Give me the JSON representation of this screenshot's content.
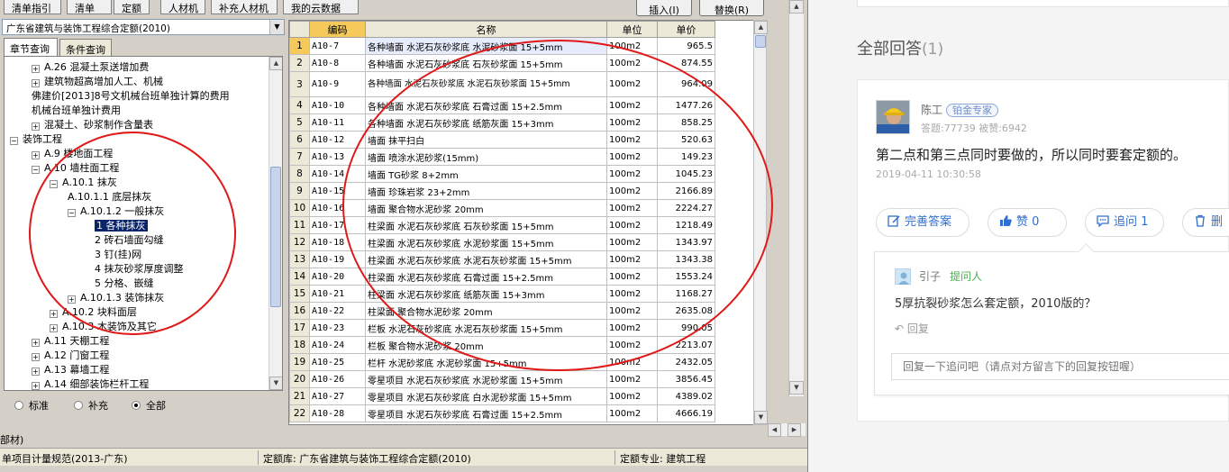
{
  "app": {
    "top_tabs": [
      "清单指引",
      "清单",
      "定额",
      "人材机",
      "补充人材机",
      "我的云数据"
    ],
    "insert_button": "插入(I)",
    "replace_button": "替换(R)",
    "quota_library": "广东省建筑与装饰工程综合定额(2010)",
    "sub_tabs": [
      "章节查询",
      "条件查询"
    ],
    "tree": [
      {
        "label": "A.26 混凝土泵送增加费",
        "level": 1,
        "expander": "+"
      },
      {
        "label": "建筑物超高增加人工、机械",
        "level": 1,
        "expander": "+"
      },
      {
        "label": "佛建价[2013]8号文机械台班单独计算的费用",
        "level": 1,
        "expander": ""
      },
      {
        "label": "机械台班单独计费用",
        "level": 1,
        "expander": ""
      },
      {
        "label": "混凝土、砂浆制作含量表",
        "level": 1,
        "expander": "+"
      },
      {
        "label": "装饰工程",
        "level": 0,
        "expander": "−"
      },
      {
        "label": "A.9 楼地面工程",
        "level": 1,
        "expander": "+"
      },
      {
        "label": "A.10 墙柱面工程",
        "level": 1,
        "expander": "−"
      },
      {
        "label": "A.10.1 抹灰",
        "level": 2,
        "expander": "−"
      },
      {
        "label": "A.10.1.1 底层抹灰",
        "level": 3,
        "expander": ""
      },
      {
        "label": "A.10.1.2 一般抹灰",
        "level": 3,
        "expander": "−"
      },
      {
        "label": "1 各种抹灰",
        "level": 4,
        "expander": "",
        "selected": true
      },
      {
        "label": "2 砖石墙面勾缝",
        "level": 4,
        "expander": ""
      },
      {
        "label": "3 钉(挂)网",
        "level": 4,
        "expander": ""
      },
      {
        "label": "4 抹灰砂浆厚度调整",
        "level": 4,
        "expander": ""
      },
      {
        "label": "5 分格、嵌缝",
        "level": 4,
        "expander": ""
      },
      {
        "label": "A.10.1.3 装饰抹灰",
        "level": 3,
        "expander": "+"
      },
      {
        "label": "A.10.2 块料面层",
        "level": 2,
        "expander": "+"
      },
      {
        "label": "A.10.3 木装饰及其它",
        "level": 2,
        "expander": "+"
      },
      {
        "label": "A.11 天棚工程",
        "level": 1,
        "expander": "+"
      },
      {
        "label": "A.12 门窗工程",
        "level": 1,
        "expander": "+"
      },
      {
        "label": "A.13 幕墙工程",
        "level": 1,
        "expander": "+"
      },
      {
        "label": "A.14 细部装饰栏杆工程",
        "level": 1,
        "expander": "+"
      }
    ],
    "filters": [
      {
        "label": "标准",
        "checked": false
      },
      {
        "label": "补充",
        "checked": false
      },
      {
        "label": "全部",
        "checked": true
      }
    ],
    "grid_headers": [
      "编码",
      "名称",
      "单位",
      "单价"
    ],
    "grid_rows": [
      {
        "idx": "1",
        "code": "A10-7",
        "name": "各种墙面 水泥石灰砂浆底 水泥砂浆面 15+5mm",
        "unit": "100m2",
        "price": "965.5",
        "selected": true
      },
      {
        "idx": "2",
        "code": "A10-8",
        "name": "各种墙面 水泥石灰砂浆底 石灰砂浆面 15+5mm",
        "unit": "100m2",
        "price": "874.55"
      },
      {
        "idx": "3",
        "code": "A10-9",
        "name": "各种墙面 水泥石灰砂浆底 水泥石灰砂浆面 15+5mm",
        "unit": "100m2",
        "price": "964.09",
        "tall": true
      },
      {
        "idx": "4",
        "code": "A10-10",
        "name": "各种墙面 水泥石灰砂浆底 石膏过面 15+2.5mm",
        "unit": "100m2",
        "price": "1477.26"
      },
      {
        "idx": "5",
        "code": "A10-11",
        "name": "各种墙面 水泥石灰砂浆底 纸筋灰面 15+3mm",
        "unit": "100m2",
        "price": "858.25"
      },
      {
        "idx": "6",
        "code": "A10-12",
        "name": "墙面 抹平扫白",
        "unit": "100m2",
        "price": "520.63"
      },
      {
        "idx": "7",
        "code": "A10-13",
        "name": "墙面 喷涂水泥砂浆(15mm)",
        "unit": "100m2",
        "price": "149.23"
      },
      {
        "idx": "8",
        "code": "A10-14",
        "name": "墙面 TG砂浆 8+2mm",
        "unit": "100m2",
        "price": "1045.23"
      },
      {
        "idx": "9",
        "code": "A10-15",
        "name": "墙面 珍珠岩浆 23+2mm",
        "unit": "100m2",
        "price": "2166.89"
      },
      {
        "idx": "10",
        "code": "A10-16",
        "name": "墙面 聚合物水泥砂浆 20mm",
        "unit": "100m2",
        "price": "2224.27"
      },
      {
        "idx": "11",
        "code": "A10-17",
        "name": "柱梁面 水泥石灰砂浆底 石灰砂浆面 15+5mm",
        "unit": "100m2",
        "price": "1218.49"
      },
      {
        "idx": "12",
        "code": "A10-18",
        "name": "柱梁面 水泥石灰砂浆底 水泥砂浆面 15+5mm",
        "unit": "100m2",
        "price": "1343.97"
      },
      {
        "idx": "13",
        "code": "A10-19",
        "name": "柱梁面 水泥石灰砂浆底 水泥石灰砂浆面 15+5mm",
        "unit": "100m2",
        "price": "1343.38"
      },
      {
        "idx": "14",
        "code": "A10-20",
        "name": "柱梁面 水泥石灰砂浆底 石膏过面 15+2.5mm",
        "unit": "100m2",
        "price": "1553.24"
      },
      {
        "idx": "15",
        "code": "A10-21",
        "name": "柱梁面 水泥石灰砂浆底 纸筋灰面 15+3mm",
        "unit": "100m2",
        "price": "1168.27"
      },
      {
        "idx": "16",
        "code": "A10-22",
        "name": "柱梁面 聚合物水泥砂浆 20mm",
        "unit": "100m2",
        "price": "2635.08"
      },
      {
        "idx": "17",
        "code": "A10-23",
        "name": "栏板 水泥石灰砂浆底 水泥石灰砂浆面 15+5mm",
        "unit": "100m2",
        "price": "990.05"
      },
      {
        "idx": "18",
        "code": "A10-24",
        "name": "栏板 聚合物水泥砂浆 20mm",
        "unit": "100m2",
        "price": "2213.07"
      },
      {
        "idx": "19",
        "code": "A10-25",
        "name": "栏杆 水泥砂浆底 水泥砂浆面 15+5mm",
        "unit": "100m2",
        "price": "2432.05"
      },
      {
        "idx": "20",
        "code": "A10-26",
        "name": "零星项目 水泥石灰砂浆底 水泥砂浆面 15+5mm",
        "unit": "100m2",
        "price": "3856.45"
      },
      {
        "idx": "21",
        "code": "A10-27",
        "name": "零星项目 水泥石灰砂浆底 白水泥砂浆面 15+5mm",
        "unit": "100m2",
        "price": "4389.02"
      },
      {
        "idx": "22",
        "code": "A10-28",
        "name": "零星项目 水泥石灰砂浆底 石膏过面 15+2.5mm",
        "unit": "100m2",
        "price": "4666.19"
      }
    ],
    "status_bar": {
      "spec": "单项目计量规范(2013-广东)",
      "library": "定额库: 广东省建筑与装饰工程综合定额(2010)",
      "discipline": "定额专业: 建筑工程"
    },
    "left_edge_label": "部材)"
  },
  "qa": {
    "heading": "全部回答",
    "heading_count": "(1)",
    "answer": {
      "author": "陈工",
      "badge": "铂金专家",
      "stats": "答题:77739   被赞:6942",
      "body": "第二点和第三点同时要做的，所以同时要套定额的。",
      "time": "2019-04-11 10:30:58"
    },
    "actions": {
      "improve": "完善答案",
      "like": "赞 0",
      "followup": "追问 1",
      "delete": "删"
    },
    "followup": {
      "author": "引子",
      "role": "提问人",
      "question": "5厚抗裂砂浆怎么套定额，2010版的？",
      "reply_label": "回复",
      "input_placeholder": "回复一下追问吧（请点对方留言下的回复按钮喔）"
    }
  },
  "colors": {
    "annotation_red": "#e01818",
    "grid_header_highlight": "#f5c95a",
    "selection_navy": "#0a246a",
    "link_blue": "#2f6fd0",
    "asker_green": "#4caf50"
  }
}
